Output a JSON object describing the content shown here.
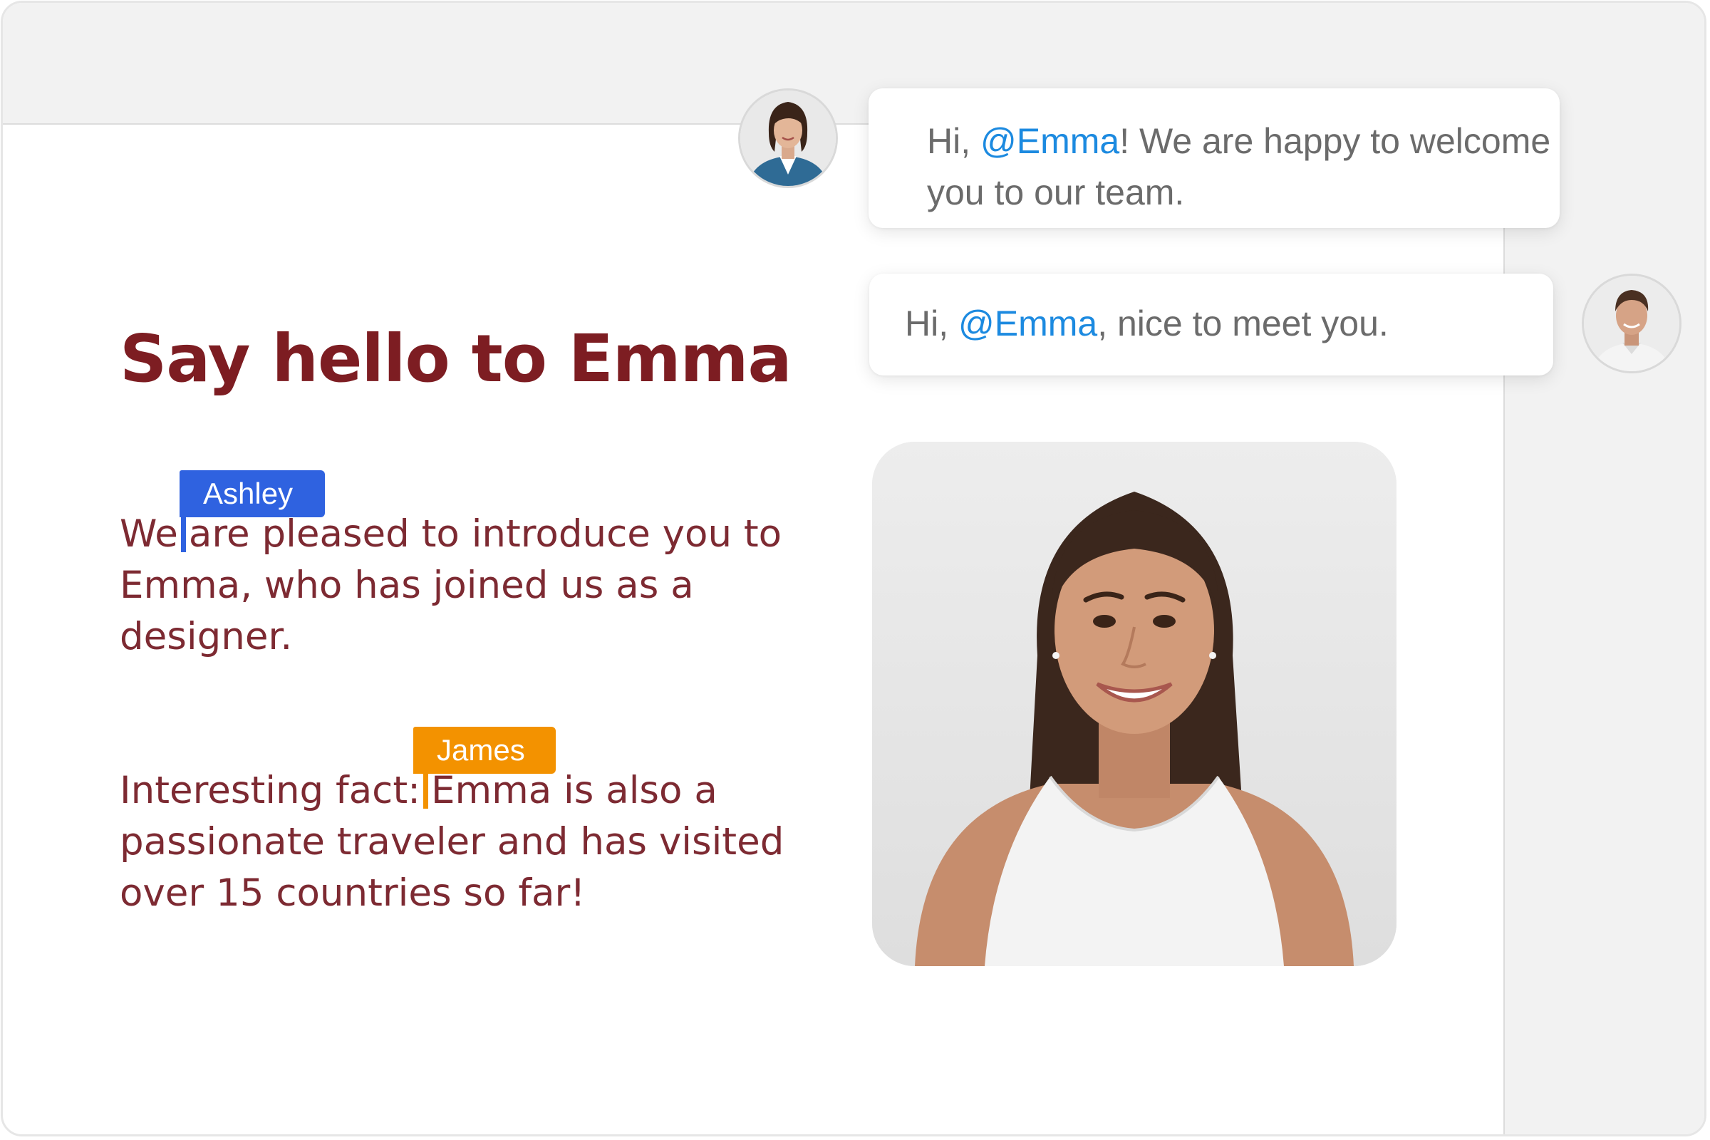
{
  "document": {
    "title": "Say hello to Emma",
    "paragraph1": {
      "before_caret": "We",
      "after_caret": "are pleased to introduce you to Emma, who has joined us as a designer."
    },
    "paragraph2": {
      "before_caret": "Interesting fact:",
      "after_caret": "Emma is also a passionate traveler and has visited over 15 countries so far!"
    }
  },
  "collaborators": [
    {
      "name": "Ashley",
      "color": "#2f62e0"
    },
    {
      "name": "James",
      "color": "#f39200"
    }
  ],
  "comments": [
    {
      "prefix": "Hi, ",
      "mention": "@Emma",
      "suffix": "! We are happy to welcome you to our team.",
      "avatar": "woman-avatar"
    },
    {
      "prefix": "Hi, ",
      "mention": "@Emma",
      "suffix": ", nice to meet you.",
      "avatar": "man-avatar"
    }
  ],
  "colors": {
    "title": "#7d1d22",
    "body_text": "#7d2a32",
    "mention": "#1c8ae0",
    "chrome": "#f2f2f2"
  },
  "icons": {
    "portrait": "portrait-photo"
  }
}
